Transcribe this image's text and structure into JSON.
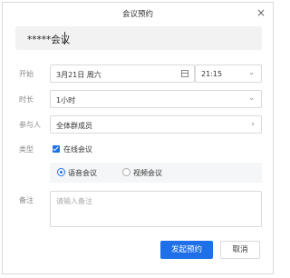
{
  "dialog": {
    "title": "会议预约",
    "close_icon": "close-icon"
  },
  "subject": {
    "value": "*****会议"
  },
  "start": {
    "label": "开始",
    "date": "3月21日 周六",
    "time": "21:15"
  },
  "duration": {
    "label": "时长",
    "value": "1小时"
  },
  "participants": {
    "label": "参与人",
    "value": "全体群成员"
  },
  "type": {
    "label": "类型",
    "online_label": "在线会议",
    "online_checked": true,
    "voice_label": "语音会议",
    "video_label": "视频会议",
    "selected": "语音会议"
  },
  "notes": {
    "label": "备注",
    "placeholder": "请输入备注"
  },
  "buttons": {
    "submit": "发起预约",
    "cancel": "取消"
  },
  "colors": {
    "accent": "#1e6fe8"
  }
}
